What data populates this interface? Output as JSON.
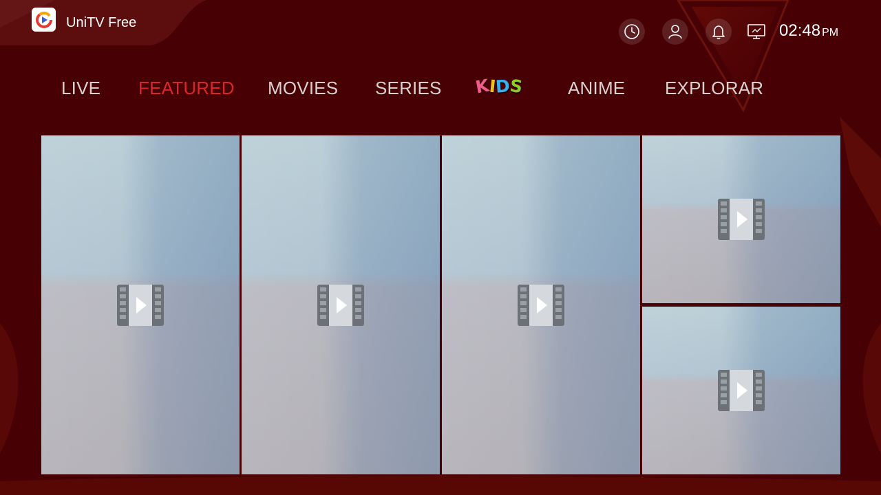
{
  "app": {
    "title": "UniTV Free",
    "logo_icon": "unitv-logo-icon"
  },
  "header": {
    "icons": [
      "history-clock-icon",
      "user-profile-icon",
      "notification-bell-icon",
      "screen-cast-icon"
    ],
    "time": "02:48",
    "ampm": "PM"
  },
  "nav": {
    "tabs": [
      {
        "label": "LIVE",
        "active": false
      },
      {
        "label": "FEATURED",
        "active": true
      },
      {
        "label": "MOVIES",
        "active": false
      },
      {
        "label": "SERIES",
        "active": false
      },
      {
        "label": "KIDS",
        "active": false,
        "letters": [
          "K",
          "I",
          "D",
          "S"
        ],
        "letter_colors": [
          "#f15c8a",
          "#f2c01c",
          "#37b2ee",
          "#8ccc2b"
        ]
      },
      {
        "label": "ANIME",
        "active": false
      },
      {
        "label": "EXPLORAR",
        "active": false
      }
    ]
  },
  "featured": {
    "tiles": [
      {
        "icon": "video-placeholder-icon"
      },
      {
        "icon": "video-placeholder-icon"
      },
      {
        "icon": "video-placeholder-icon"
      },
      {
        "icon": "video-placeholder-icon"
      },
      {
        "icon": "video-placeholder-icon"
      }
    ]
  },
  "colors": {
    "background": "#470003",
    "active_tab": "#d7272b",
    "tab_text": "#d9d0d0"
  }
}
